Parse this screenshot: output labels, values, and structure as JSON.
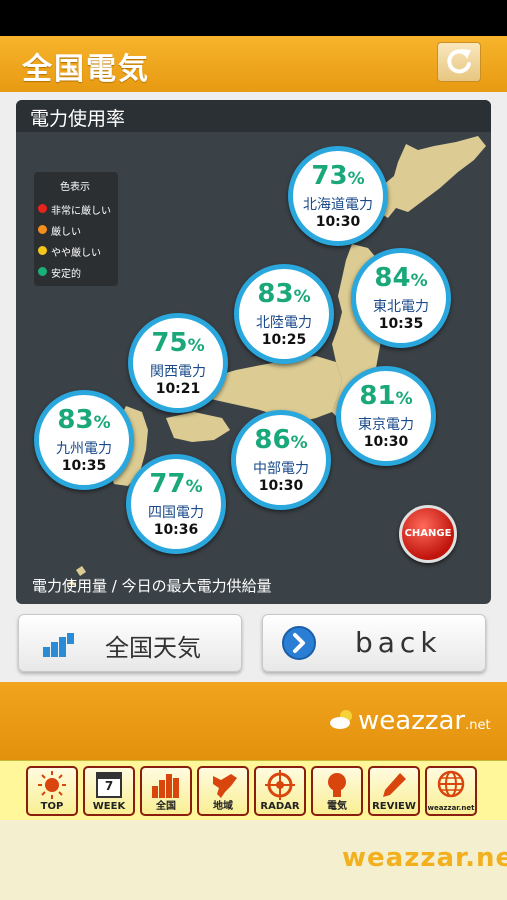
{
  "header": {
    "title": "全国電気",
    "reload_icon": "reload-icon"
  },
  "panel": {
    "title": "電力使用率",
    "legend": {
      "title": "色表示",
      "items": [
        {
          "label": "非常に厳しい",
          "color": "#e8231d"
        },
        {
          "label": "厳しい",
          "color": "#f3901c"
        },
        {
          "label": "やや厳しい",
          "color": "#f5c71a"
        },
        {
          "label": "安定的",
          "color": "#1ab07a"
        }
      ]
    },
    "regions": [
      {
        "pct": "73",
        "unit": "%",
        "name": "北海道電力",
        "time": "10:30"
      },
      {
        "pct": "84",
        "unit": "%",
        "name": "東北電力",
        "time": "10:35"
      },
      {
        "pct": "83",
        "unit": "%",
        "name": "北陸電力",
        "time": "10:25"
      },
      {
        "pct": "75",
        "unit": "%",
        "name": "関西電力",
        "time": "10:21"
      },
      {
        "pct": "81",
        "unit": "%",
        "name": "東京電力",
        "time": "10:30"
      },
      {
        "pct": "83",
        "unit": "%",
        "name": "九州電力",
        "time": "10:35"
      },
      {
        "pct": "86",
        "unit": "%",
        "name": "中部電力",
        "time": "10:30"
      },
      {
        "pct": "77",
        "unit": "%",
        "name": "四国電力",
        "time": "10:36"
      }
    ],
    "change_label": "CHANGE",
    "caption": "電力使用量 / 今日の最大電力供給量"
  },
  "buttons": {
    "national_weather": "全国天気",
    "back": "back"
  },
  "brand": {
    "name": "weazzar",
    "suffix": ".net"
  },
  "tabs": [
    {
      "label": "TOP",
      "icon": "sun-icon"
    },
    {
      "label": "WEEK",
      "icon": "calendar-icon",
      "day": "7"
    },
    {
      "label": "全国",
      "icon": "bars-icon"
    },
    {
      "label": "地域",
      "icon": "hokkaido-icon"
    },
    {
      "label": "RADAR",
      "icon": "radar-icon"
    },
    {
      "label": "電気",
      "icon": "lightbulb-icon"
    },
    {
      "label": "REVIEW",
      "icon": "pencil-icon"
    },
    {
      "label": "weazzar.net",
      "icon": "globe-icon"
    }
  ],
  "footer": {
    "logo": "weazzar.net"
  }
}
